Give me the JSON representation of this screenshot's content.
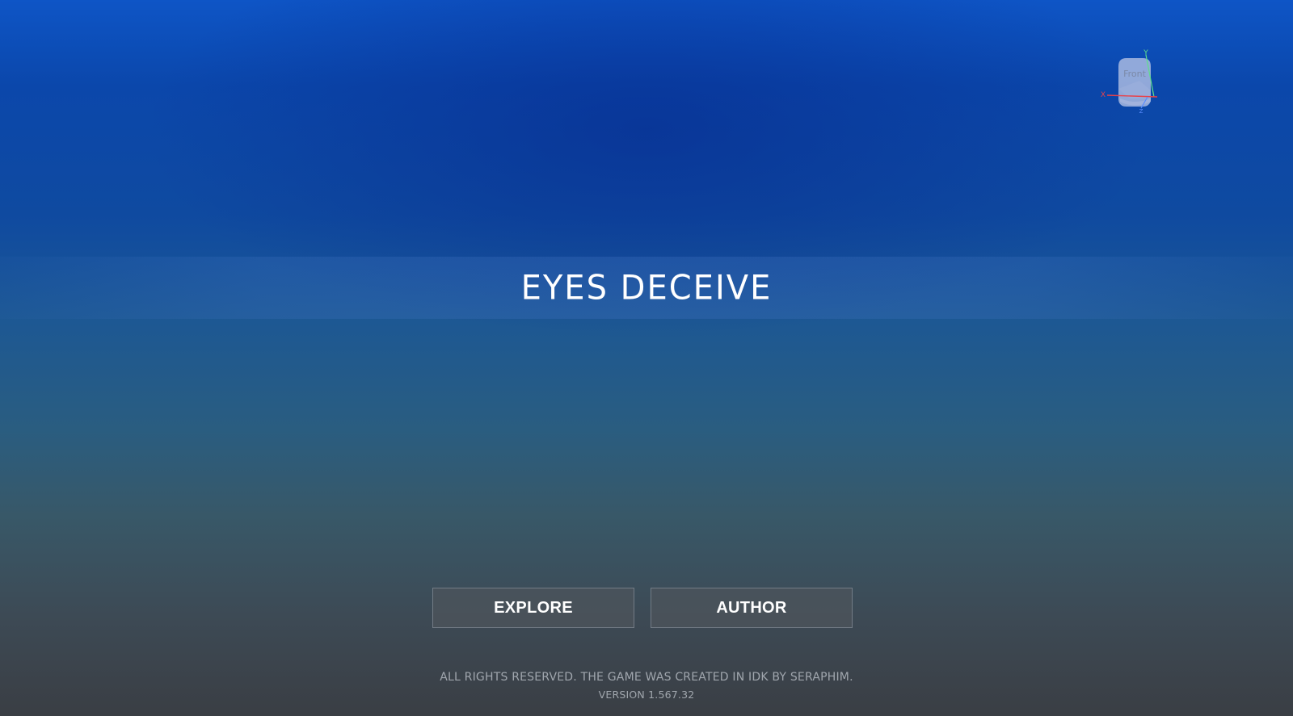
{
  "title": "EYES DECEIVE",
  "gizmo": {
    "face_label": "Front",
    "axis_y": "Y",
    "axis_x": "X",
    "axis_z": "Z",
    "colors": {
      "x_axis": "#e8424a",
      "y_axis": "#5fe08a",
      "z_axis": "#5a8dff",
      "cube": "#b7c4e6"
    }
  },
  "buttons": {
    "explore": "EXPLORE",
    "author": "AUTHOR"
  },
  "footer": {
    "copyright": "ALL RIGHTS RESERVED. THE GAME WAS CREATED IN IDK BY SERAPHIM.",
    "version": "VERSION 1.567.32"
  },
  "colors": {
    "background_top": "#0e55c6",
    "background_bottom": "#3a3e44",
    "button_bg": "#4e545c",
    "text": "#ffffff"
  }
}
